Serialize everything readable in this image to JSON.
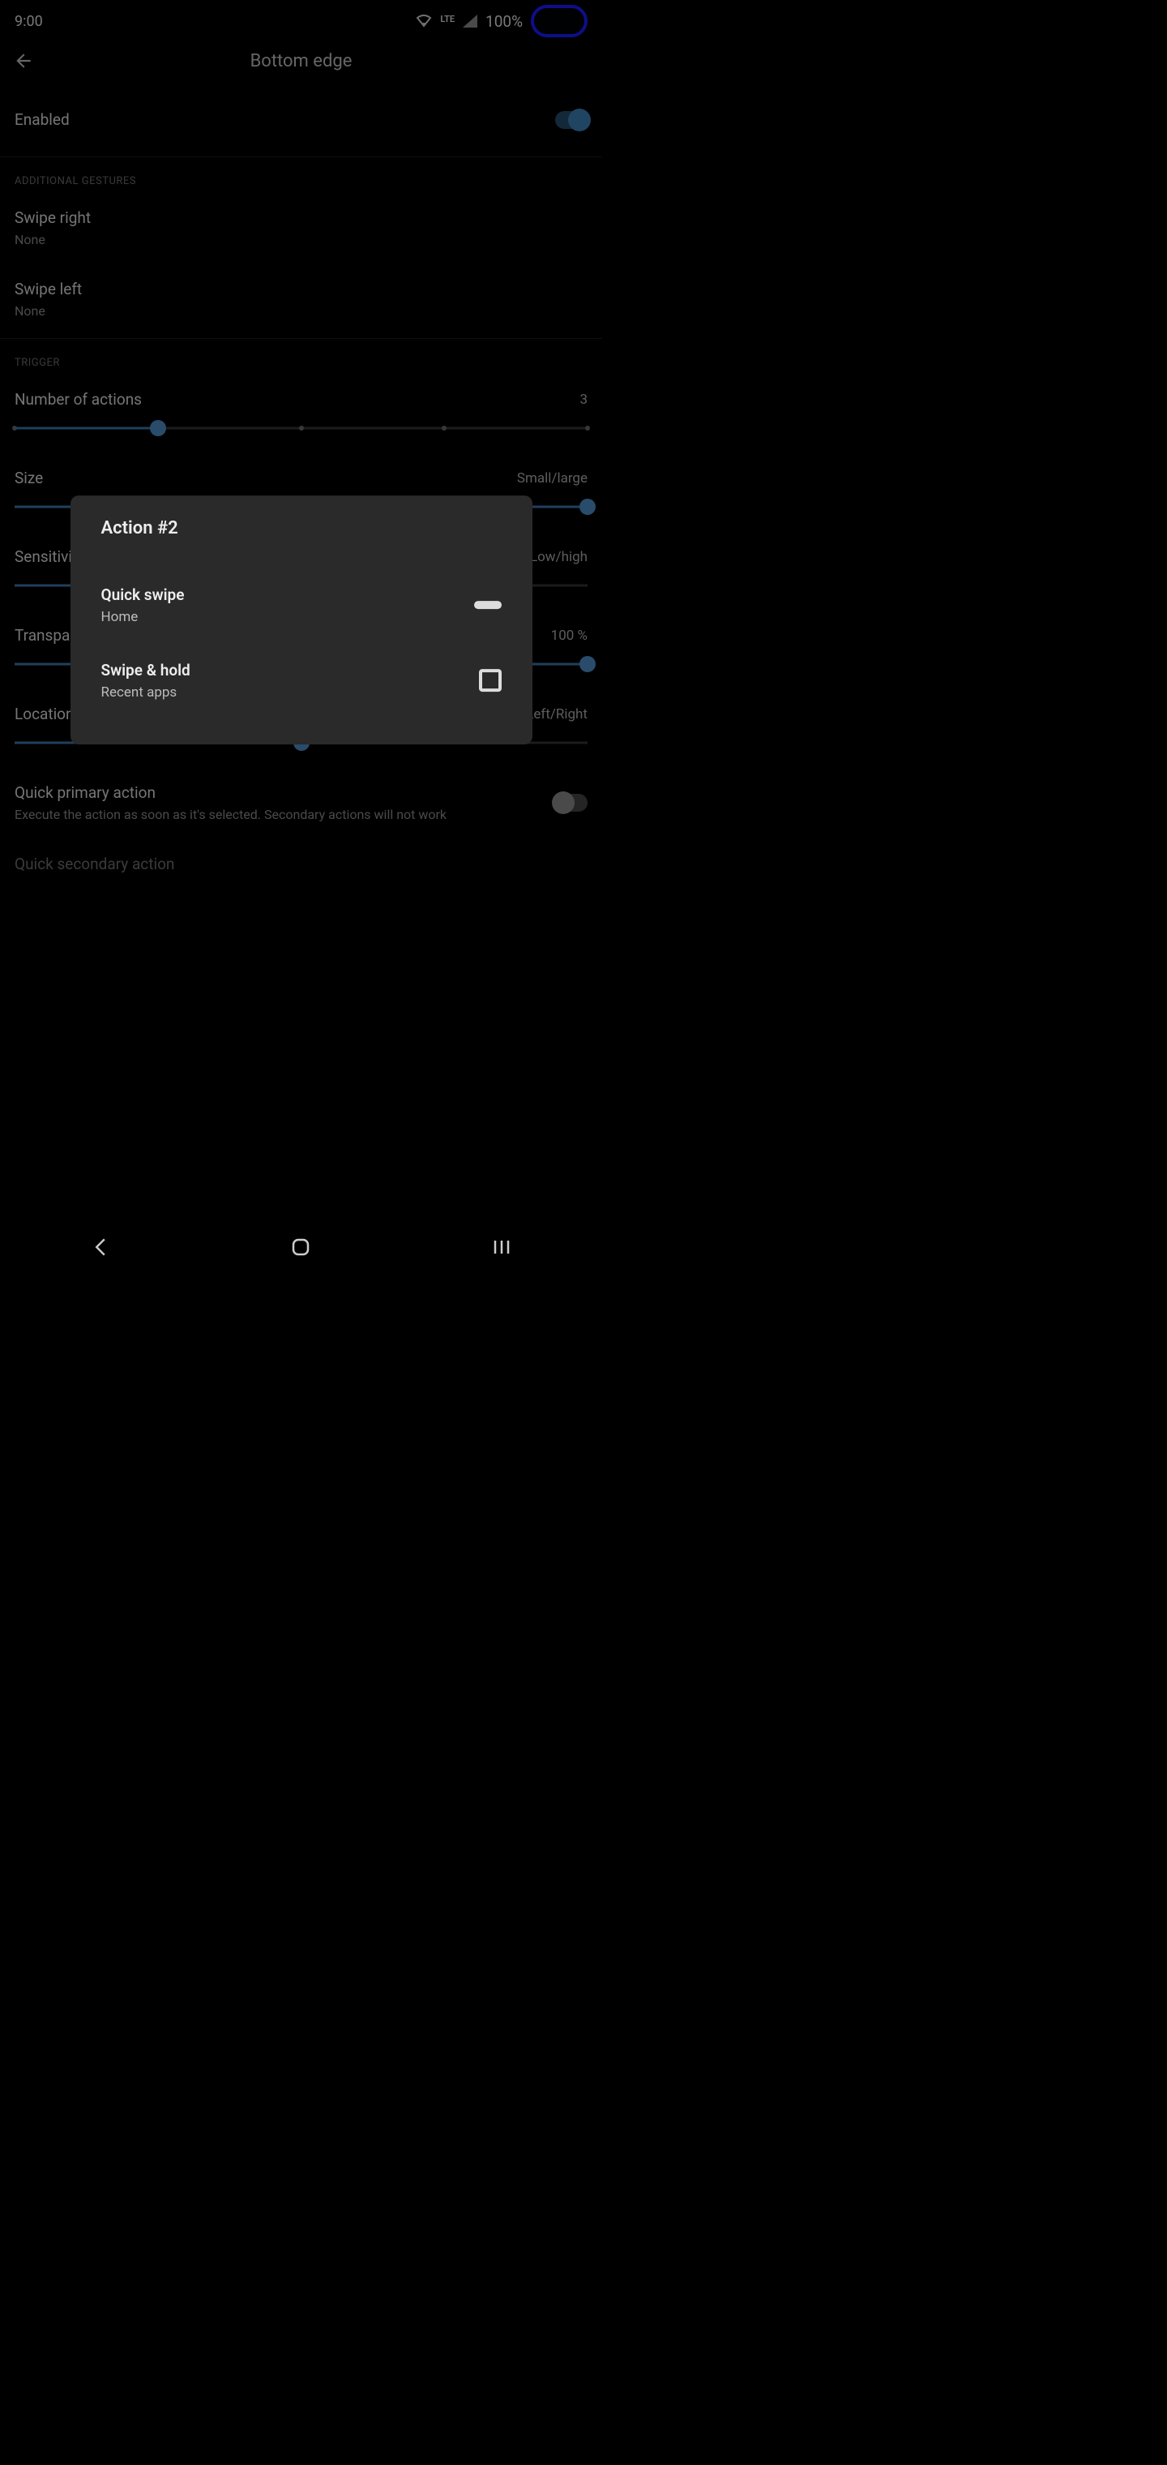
{
  "status": {
    "time": "9:00",
    "lte": "LTE",
    "battery": "100%"
  },
  "header": {
    "title": "Bottom edge"
  },
  "enabled": {
    "label": "Enabled"
  },
  "sections": {
    "gestures_label": "ADDITIONAL GESTURES",
    "trigger_label": "TRIGGER"
  },
  "swipe_right": {
    "title": "Swipe right",
    "value": "None"
  },
  "swipe_left": {
    "title": "Swipe left",
    "value": "None"
  },
  "number": {
    "title": "Number of actions",
    "value": "3"
  },
  "size": {
    "title": "Size",
    "range": "Small/large"
  },
  "sensitivity": {
    "title": "Sensitivity",
    "range": "Low/high"
  },
  "transparency": {
    "title": "Transparency",
    "value": "100 %"
  },
  "location": {
    "title": "Location",
    "range": "Left/Right"
  },
  "quick_primary": {
    "title": "Quick primary action",
    "desc": "Execute the action as soon as it's selected. Secondary actions will not work"
  },
  "quick_secondary": {
    "title": "Quick secondary action"
  },
  "dialog": {
    "title": "Action #2",
    "item1": {
      "title": "Quick swipe",
      "sub": "Home"
    },
    "item2": {
      "title": "Swipe & hold",
      "sub": "Recent apps"
    }
  }
}
